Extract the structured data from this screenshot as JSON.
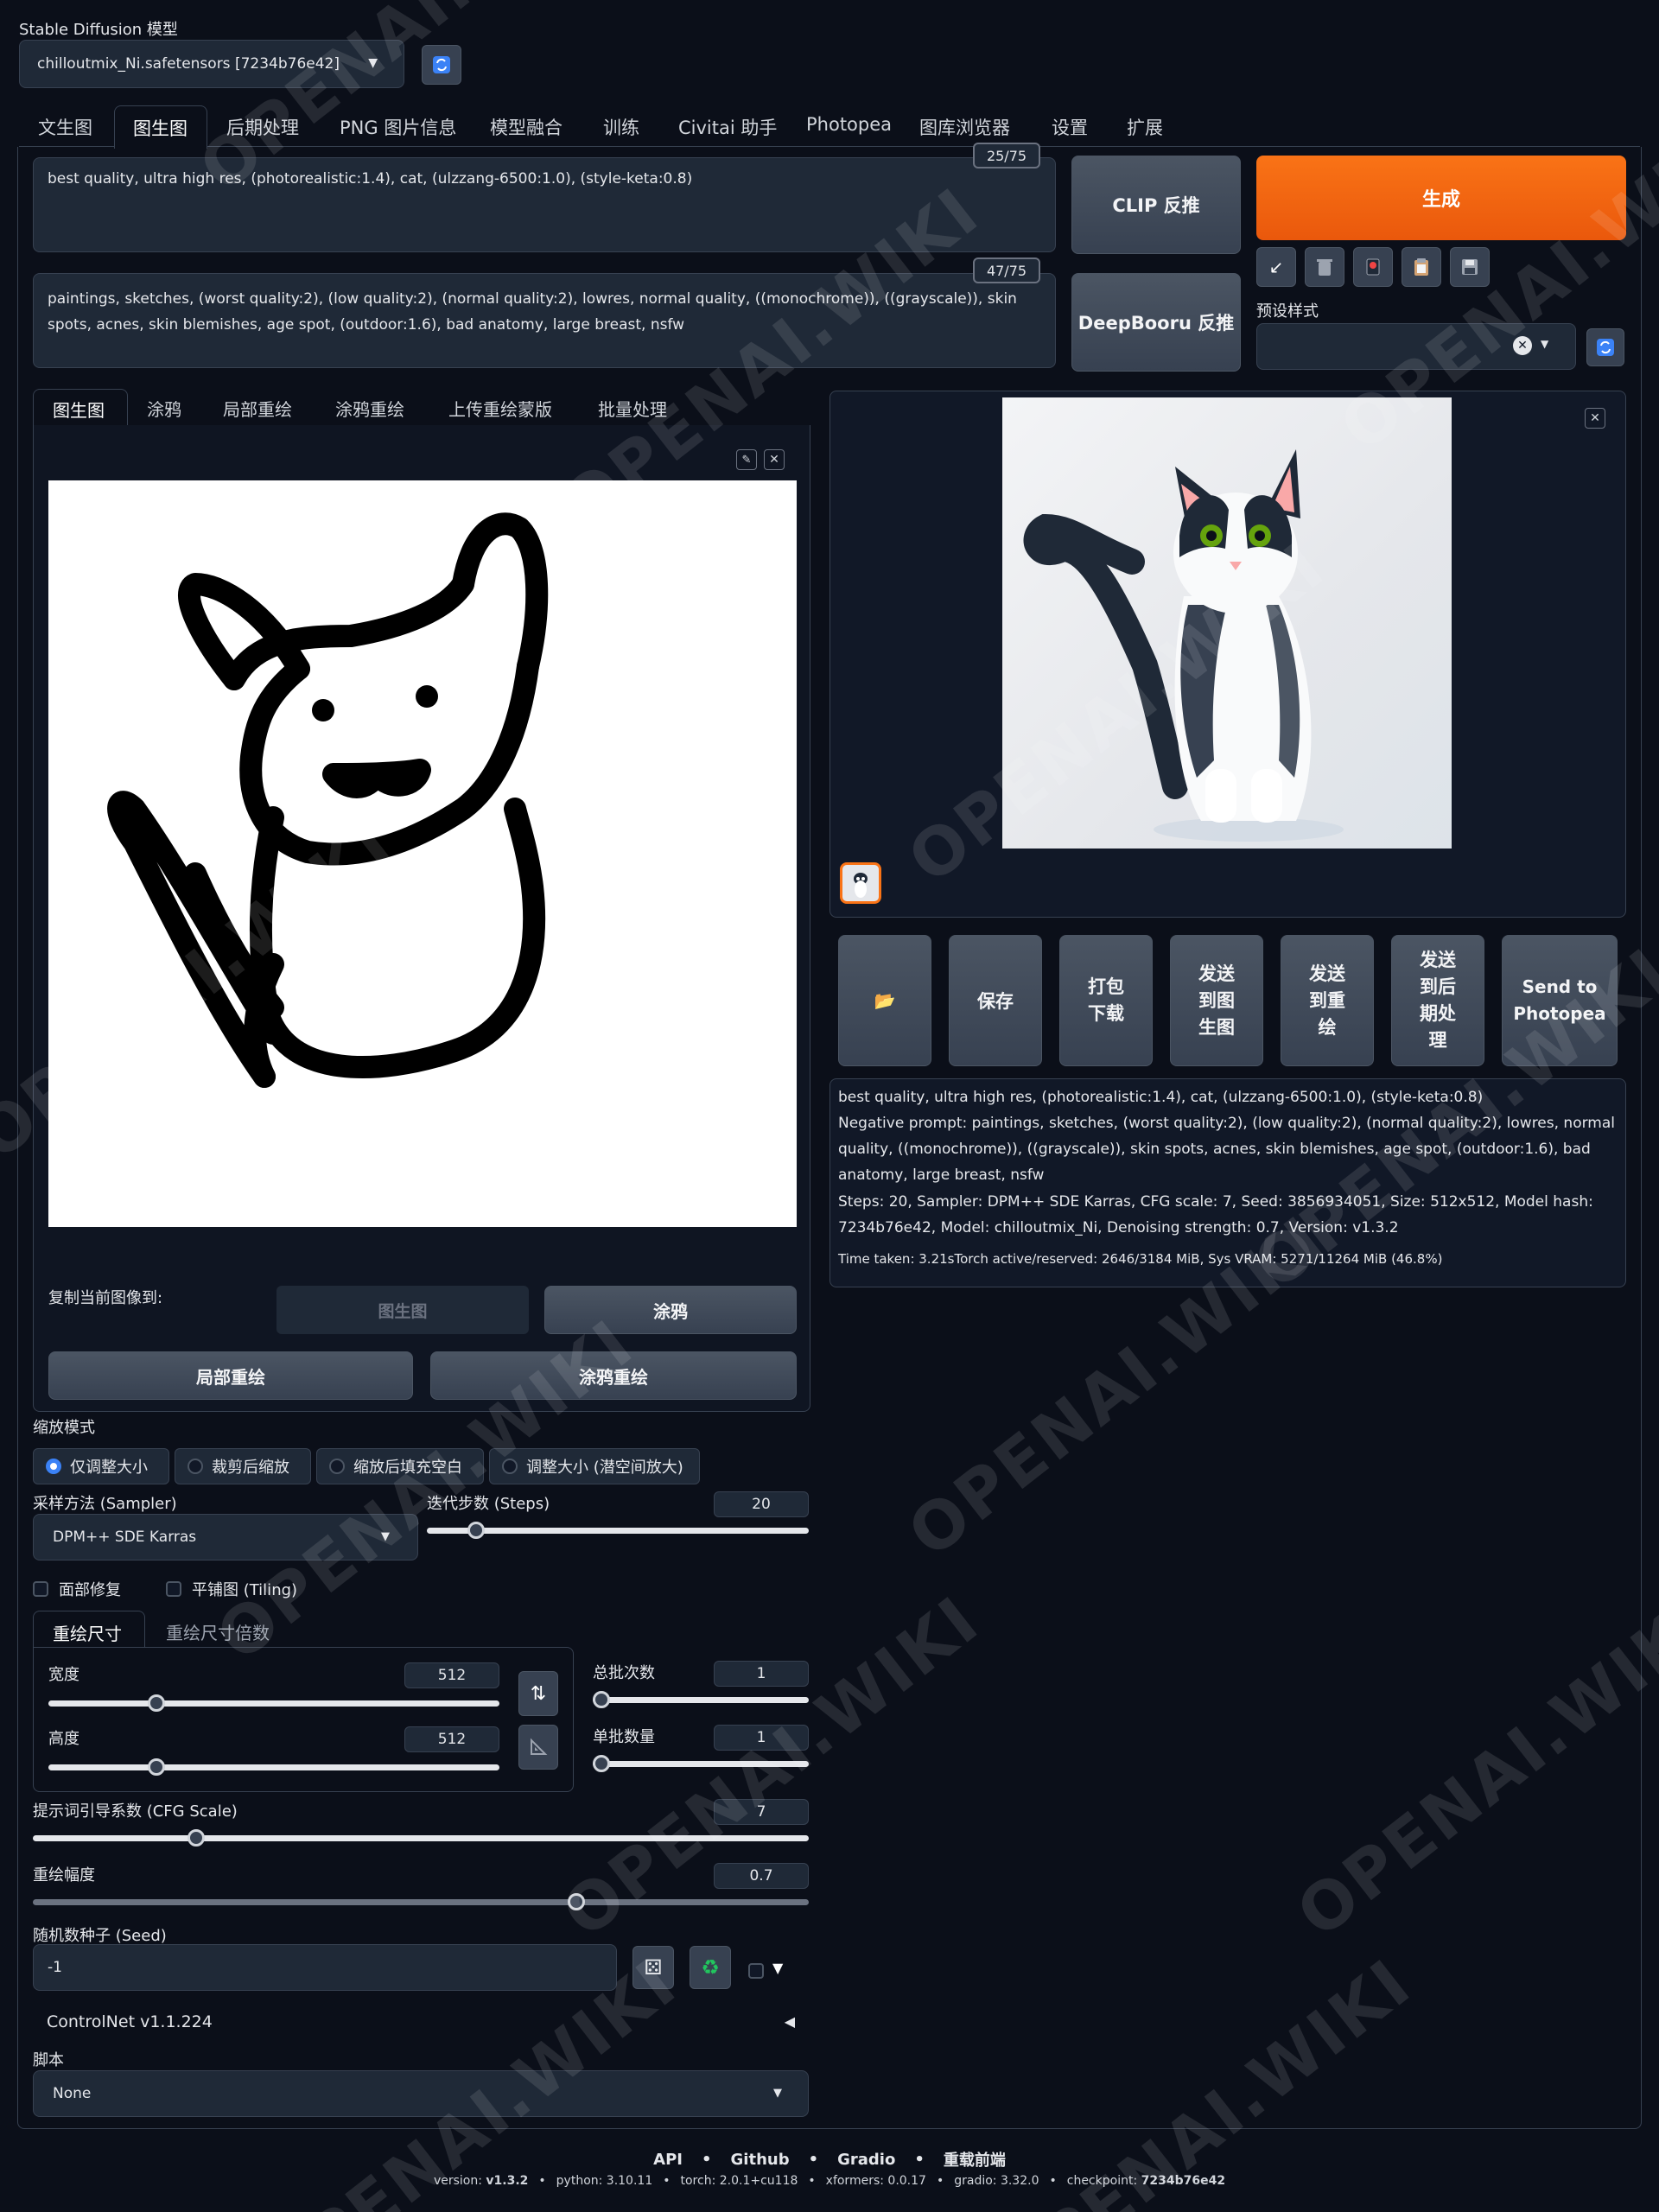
{
  "model": {
    "label": "Stable Diffusion 模型",
    "selected": "chilloutmix_Ni.safetensors [7234b76e42]"
  },
  "main_tabs": [
    "文生图",
    "图生图",
    "后期处理",
    "PNG 图片信息",
    "模型融合",
    "训练",
    "Civitai 助手",
    "Photopea",
    "图库浏览器",
    "设置",
    "扩展"
  ],
  "prompt": {
    "text": "best quality, ultra high res, (photorealistic:1.4), cat, (ulzzang-6500:1.0),  (style-keta:0.8)",
    "counter": "25/75"
  },
  "negative_prompt": {
    "text": "paintings, sketches, (worst quality:2), (low quality:2), (normal quality:2), lowres, normal quality, ((monochrome)), ((grayscale)), skin spots, acnes, skin blemishes, age spot, (outdoor:1.6), bad anatomy, large breast, nsfw",
    "counter": "47/75"
  },
  "buttons": {
    "clip": "CLIP 反推",
    "deepbooru": "DeepBooru 反推",
    "generate": "生成",
    "styles_label": "预设样式"
  },
  "img_tabs": [
    "图生图",
    "涂鸦",
    "局部重绘",
    "涂鸦重绘",
    "上传重绘蒙版",
    "批量处理"
  ],
  "copy_to": {
    "label": "复制当前图像到:",
    "img2img": "图生图",
    "sketch": "涂鸦",
    "inpaint": "局部重绘",
    "inpaint_sketch": "涂鸦重绘"
  },
  "resize_mode": {
    "label": "缩放模式",
    "options": [
      "仅调整大小",
      "裁剪后缩放",
      "缩放后填充空白",
      "调整大小 (潜空间放大)"
    ],
    "selected_index": 0
  },
  "sampler": {
    "label": "采样方法 (Sampler)",
    "value": "DPM++ SDE Karras"
  },
  "steps": {
    "label": "迭代步数 (Steps)",
    "value": "20",
    "fraction": 0.13
  },
  "checkboxes": [
    "面部修复",
    "平铺图 (Tiling)"
  ],
  "size_tabs": [
    "重绘尺寸",
    "重绘尺寸倍数"
  ],
  "width": {
    "label": "宽度",
    "value": "512",
    "fraction": 0.24
  },
  "height": {
    "label": "高度",
    "value": "512",
    "fraction": 0.24
  },
  "batch_count": {
    "label": "总批次数",
    "value": "1",
    "fraction": 0.0
  },
  "batch_size": {
    "label": "单批数量",
    "value": "1",
    "fraction": 0.0
  },
  "cfg": {
    "label": "提示词引导系数 (CFG Scale)",
    "value": "7",
    "fraction": 0.21
  },
  "denoise": {
    "label": "重绘幅度",
    "value": "0.7",
    "fraction": 0.7
  },
  "seed": {
    "label": "随机数种子 (Seed)",
    "value": "-1"
  },
  "controlnet": {
    "label": "ControlNet v1.1.224"
  },
  "script": {
    "label": "脚本",
    "value": "None"
  },
  "output_buttons": [
    "📂",
    "保存",
    "打包\n下载",
    "发送\n到图\n生图",
    "发送\n到重\n绘",
    "发送\n到后\n期处\n理",
    "Send to\nPhotopea"
  ],
  "info": {
    "prompt": "best quality, ultra high res, (photorealistic:1.4), cat, (ulzzang-6500:1.0), (style-keta:0.8)",
    "negative": "Negative prompt: paintings, sketches, (worst quality:2), (low quality:2), (normal quality:2), lowres, normal quality, ((monochrome)), ((grayscale)), skin spots, acnes, skin blemishes, age spot, (outdoor:1.6), bad anatomy, large breast, nsfw",
    "params": "Steps: 20, Sampler: DPM++ SDE Karras, CFG scale: 7, Seed: 3856934051, Size: 512x512, Model hash: 7234b76e42, Model: chilloutmix_Ni, Denoising strength: 0.7, Version: v1.3.2",
    "time": "Time taken: 3.21sTorch active/reserved: 2646/3184 MiB, Sys VRAM: 5271/11264 MiB (46.8%)"
  },
  "footer": {
    "links": [
      "API",
      "Github",
      "Gradio",
      "重载前端"
    ],
    "version_prefix": "version: ",
    "version": "v1.3.2",
    "python": "python: 3.10.11",
    "torch": "torch: 2.0.1+cu118",
    "xformers": "xformers: 0.0.17",
    "gradio": "gradio: 3.32.0",
    "checkpoint_prefix": "checkpoint: ",
    "checkpoint": "7234b76e42"
  },
  "watermark": "OPENAI.WIKI",
  "colors": {
    "generate": "#f97316",
    "bg": "#0b0f19",
    "accent": "#3b82f6"
  }
}
